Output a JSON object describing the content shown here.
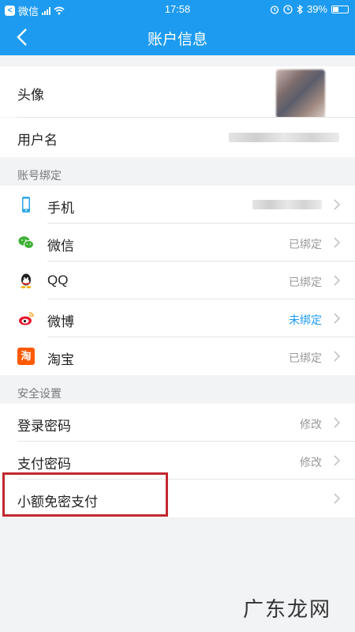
{
  "status_bar": {
    "back_app": "微信",
    "time": "17:58",
    "battery": "39%",
    "battery_level": 0.39
  },
  "nav": {
    "title": "账户信息"
  },
  "profile": {
    "avatar_label": "头像",
    "username_label": "用户名"
  },
  "binding": {
    "section_title": "账号绑定",
    "items": [
      {
        "label": "手机",
        "status": "",
        "icon": "phone-icon"
      },
      {
        "label": "微信",
        "status": "已绑定",
        "icon": "wechat-icon"
      },
      {
        "label": "QQ",
        "status": "已绑定",
        "icon": "qq-icon"
      },
      {
        "label": "微博",
        "status": "未绑定",
        "icon": "weibo-icon"
      },
      {
        "label": "淘宝",
        "status": "已绑定",
        "icon": "taobao-icon",
        "glyph": "淘"
      }
    ]
  },
  "security": {
    "section_title": "安全设置",
    "items": [
      {
        "label": "登录密码",
        "action": "修改"
      },
      {
        "label": "支付密码",
        "action": "修改"
      },
      {
        "label": "小额免密支付",
        "action": ""
      }
    ]
  },
  "watermark": {
    "text": "广东龙网",
    "sub": ""
  },
  "colors": {
    "brand": "#1d9bf0",
    "unbound": "#1d9bf0",
    "highlight": "#c0282e"
  }
}
